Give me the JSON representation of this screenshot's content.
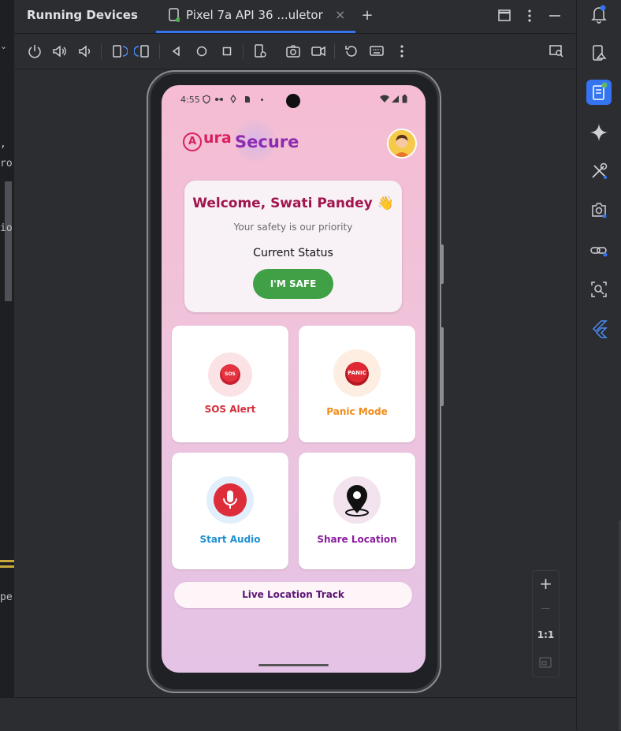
{
  "window": {
    "panel_title": "Running Devices",
    "device_tab_label": "Pixel 7a API 36 ...uletor",
    "close_glyph": "×",
    "add_glyph": "+"
  },
  "left_code": [
    ",",
    "ro",
    "io",
    "pe"
  ],
  "phone": {
    "status_time": "4:55",
    "status_icons": [
      "shield-icon",
      "sync-icon",
      "android-icon",
      "sim-icon",
      "dot-icon"
    ],
    "status_right_icons": [
      "wifi-icon",
      "signal-icon",
      "battery-icon"
    ],
    "logo_letter": "A",
    "logo_ura": "ura",
    "logo_secure": "Secure",
    "welcome": {
      "title": "Welcome, Swati Pandey 👋",
      "subtitle": "Your safety is our priority",
      "status_label": "Current Status",
      "safe_button": "I'M SAFE"
    },
    "actions": [
      {
        "label": "SOS Alert",
        "badge": "SOS",
        "color": "#d32f3c"
      },
      {
        "label": "Panic Mode",
        "badge": "PANIC",
        "color": "#f28c1a"
      },
      {
        "label": "Start Audio",
        "badge": "",
        "color": "#1f8fd1"
      },
      {
        "label": "Share Location",
        "badge": "",
        "color": "#8a1c9c"
      }
    ],
    "live_button": "Live Location Track"
  },
  "zoom": {
    "plus": "+",
    "minus": "—",
    "one_to_one": "1:1"
  },
  "colors": {
    "accent": "#3574f0",
    "safe_green": "#3fa045",
    "brand_pink": "#d8205c",
    "brand_purple": "#8e2bb0"
  }
}
